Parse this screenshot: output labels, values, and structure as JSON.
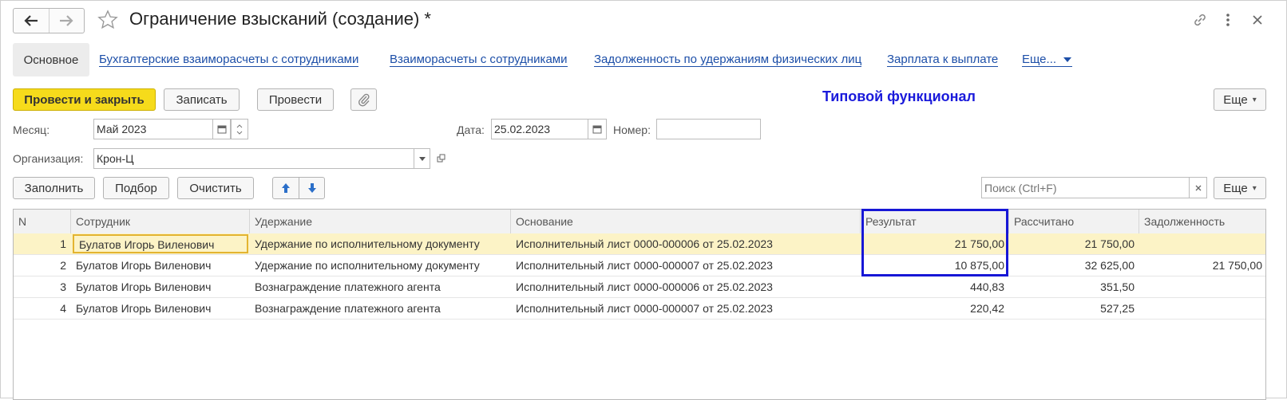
{
  "header": {
    "title": "Ограничение взысканий (создание) *"
  },
  "tabs": [
    {
      "label": "Основное",
      "active": true
    },
    {
      "label": "Бухгалтерские взаиморасчеты с сотрудниками"
    },
    {
      "label": "Взаиморасчеты с сотрудниками"
    },
    {
      "label": "Задолженность по удержаниям физических лиц"
    },
    {
      "label": "Зарплата к выплате"
    },
    {
      "label": "Еще..."
    }
  ],
  "toolbar": {
    "post_close": "Провести и закрыть",
    "save": "Записать",
    "post": "Провести",
    "more": "Еще"
  },
  "annotation": "Типовой функционал",
  "form": {
    "month_label": "Месяц:",
    "month_value": "Май 2023",
    "date_label": "Дата:",
    "date_value": "25.02.2023",
    "number_label": "Номер:",
    "number_value": "",
    "org_label": "Организация:",
    "org_value": "Крон-Ц"
  },
  "table_toolbar": {
    "fill": "Заполнить",
    "pick": "Подбор",
    "clear": "Очистить",
    "search_placeholder": "Поиск (Ctrl+F)",
    "more": "Еще"
  },
  "table": {
    "columns": [
      "N",
      "Сотрудник",
      "Удержание",
      "Основание",
      "Результат",
      "Рассчитано",
      "Задолженность"
    ],
    "rows": [
      [
        "1",
        "Булатов Игорь Виленович",
        "Удержание по исполнительному документу",
        "Исполнительный лист 0000-000006 от 25.02.2023",
        "21 750,00",
        "21 750,00",
        ""
      ],
      [
        "2",
        "Булатов Игорь Виленович",
        "Удержание по исполнительному документу",
        "Исполнительный лист 0000-000007 от 25.02.2023",
        "10 875,00",
        "32 625,00",
        "21 750,00"
      ],
      [
        "3",
        "Булатов Игорь Виленович",
        "Вознаграждение платежного агента",
        "Исполнительный лист 0000-000006 от 25.02.2023",
        "440,83",
        "351,50",
        ""
      ],
      [
        "4",
        "Булатов Игорь Виленович",
        "Вознаграждение платежного агента",
        "Исполнительный лист 0000-000007 от 25.02.2023",
        "220,42",
        "527,25",
        ""
      ]
    ]
  },
  "colors": {
    "accent_yellow": "#f6db1b",
    "link_blue": "#1d4fa8",
    "highlight_blue": "#1717d6",
    "selected_row": "#fcf3c6"
  },
  "icons": [
    "back-arrow-icon",
    "forward-arrow-icon",
    "favorite-star-icon",
    "link-icon",
    "more-vertical-icon",
    "close-icon",
    "paperclip-icon",
    "calendar-icon",
    "open-link-icon",
    "arrow-up-icon",
    "arrow-down-icon"
  ]
}
